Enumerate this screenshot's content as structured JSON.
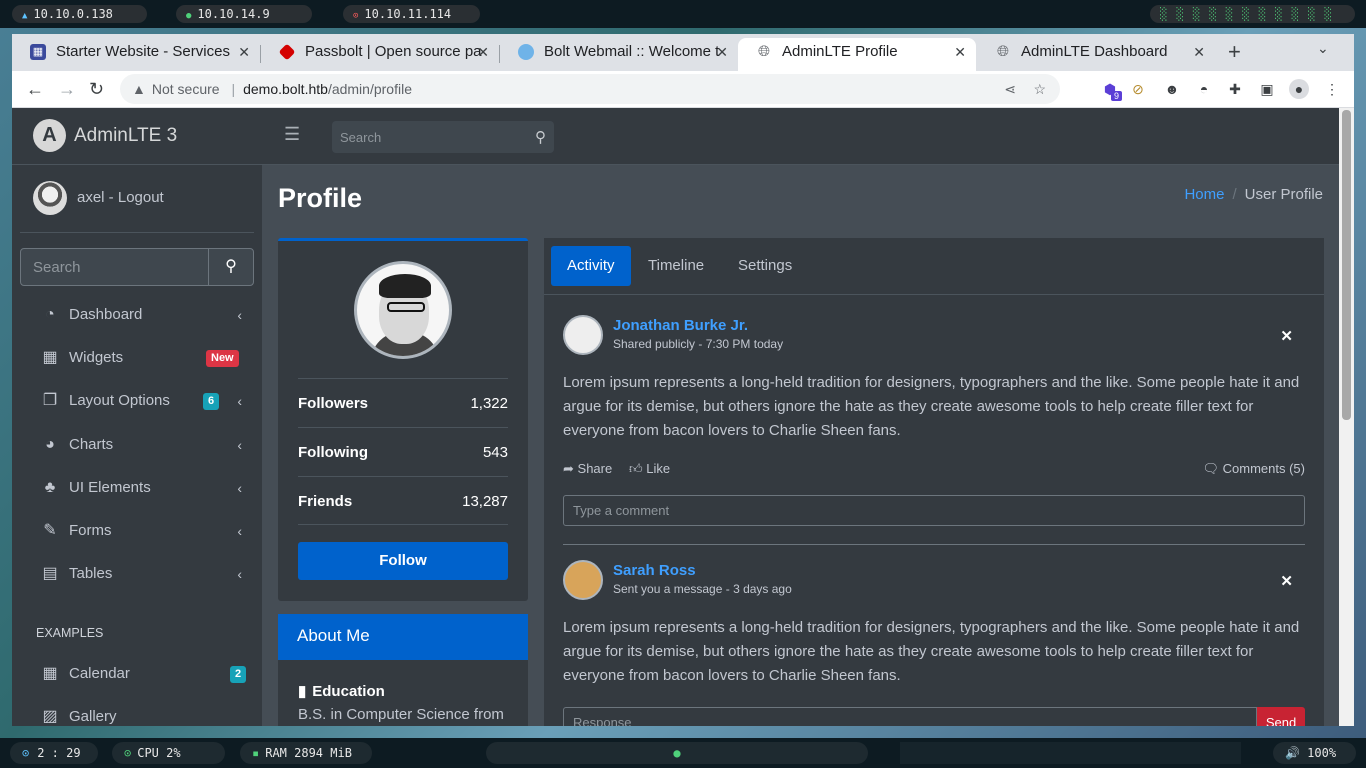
{
  "desktop": {
    "top_pills": [
      "10.10.0.138",
      "10.10.14.9",
      "10.10.11.114"
    ],
    "workspace_indicator": "░ ░ ░ ░ ░ ░ ░ ░ ░ ░ ░",
    "clock": "2 : 29",
    "cpu": "CPU 2%",
    "ram": "RAM 2894 MiB",
    "volume": "🔊 100%"
  },
  "browser": {
    "tabs": [
      {
        "label": "Starter Website - Services",
        "icon": "grid-icon"
      },
      {
        "label": "Passbolt | Open source pa",
        "icon": "passbolt-icon"
      },
      {
        "label": "Bolt Webmail :: Welcome t",
        "icon": "webmail-icon"
      },
      {
        "label": "AdminLTE Profile",
        "icon": "globe-icon"
      },
      {
        "label": "AdminLTE Dashboard",
        "icon": "globe-icon"
      }
    ],
    "security_label": "Not secure",
    "url_host": "demo.bolt.htb",
    "url_path": "/admin/profile",
    "extension_badge": "9"
  },
  "sidebar": {
    "brand": "AdminLTE 3",
    "brand_logo_letter": "A",
    "user": "axel - Logout",
    "search_placeholder": "Search",
    "items": [
      {
        "label": "Dashboard",
        "icon": "tachometer-icon"
      },
      {
        "label": "Widgets",
        "icon": "widgets-icon",
        "badge": "New"
      },
      {
        "label": "Layout Options",
        "icon": "copy-icon",
        "badge": "6"
      },
      {
        "label": "Charts",
        "icon": "pie-chart-icon"
      },
      {
        "label": "UI Elements",
        "icon": "tree-icon"
      },
      {
        "label": "Forms",
        "icon": "edit-icon"
      },
      {
        "label": "Tables",
        "icon": "table-icon"
      }
    ],
    "section_header": "EXAMPLES",
    "examples": [
      {
        "label": "Calendar",
        "icon": "calendar-icon",
        "badge": "2"
      },
      {
        "label": "Gallery",
        "icon": "image-icon"
      }
    ]
  },
  "topnav": {
    "search_placeholder": "Search"
  },
  "page": {
    "title": "Profile",
    "breadcrumb": {
      "home": "Home",
      "current": "User Profile"
    }
  },
  "profile": {
    "stats": [
      {
        "label": "Followers",
        "value": "1,322"
      },
      {
        "label": "Following",
        "value": "543"
      },
      {
        "label": "Friends",
        "value": "13,287"
      }
    ],
    "follow_label": "Follow",
    "about_title": "About Me",
    "education_label": "Education",
    "education_text": "B.S. in Computer Science from"
  },
  "main": {
    "tabs": [
      "Activity",
      "Timeline",
      "Settings"
    ],
    "posts": [
      {
        "author": "Jonathan Burke Jr.",
        "meta": "Shared publicly - 7:30 PM today",
        "text": "Lorem ipsum represents a long-held tradition for designers, typographers and the like. Some people hate it and argue for its demise, but others ignore the hate as they create awesome tools to help create filler text for everyone from bacon lovers to Charlie Sheen fans.",
        "share": "Share",
        "like": "Like",
        "comments": "Comments (5)",
        "comment_placeholder": "Type a comment"
      },
      {
        "author": "Sarah Ross",
        "meta": "Sent you a message - 3 days ago",
        "text": "Lorem ipsum represents a long-held tradition for designers, typographers and the like. Some people hate it and argue for its demise, but others ignore the hate as they create awesome tools to help create filler text for everyone from bacon lovers to Charlie Sheen fans.",
        "response_placeholder": "Response",
        "send": "Send"
      }
    ]
  },
  "colors": {
    "primary": "#0062cc",
    "link": "#3f9fff",
    "danger": "#c82333",
    "info_badge": "#17a2b8",
    "sidebar_bg": "#343a40",
    "content_bg": "#454d55"
  }
}
